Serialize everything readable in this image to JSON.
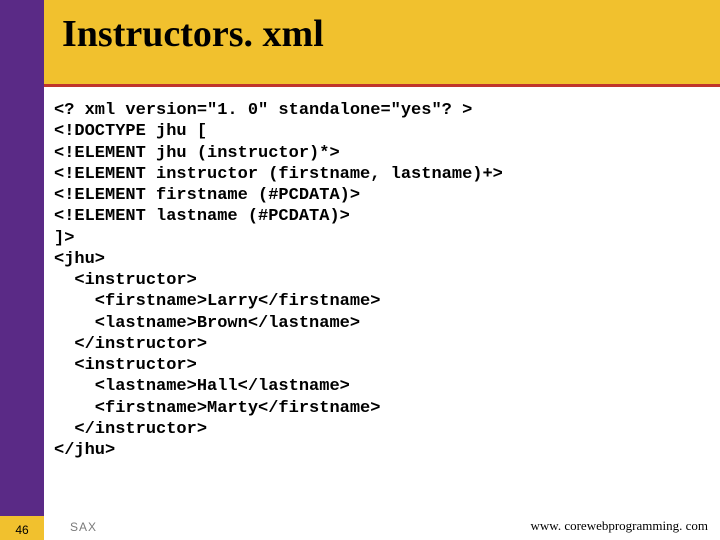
{
  "title": "Instructors. xml",
  "code": "<? xml version=\"1. 0\" standalone=\"yes\"? >\n<!DOCTYPE jhu [\n<!ELEMENT jhu (instructor)*>\n<!ELEMENT instructor (firstname, lastname)+>\n<!ELEMENT firstname (#PCDATA)>\n<!ELEMENT lastname (#PCDATA)>\n]>\n<jhu>\n  <instructor>\n    <firstname>Larry</firstname>\n    <lastname>Brown</lastname>\n  </instructor>\n  <instructor>\n    <lastname>Hall</lastname>\n    <firstname>Marty</firstname>\n  </instructor>\n</jhu>",
  "footer": {
    "page_number": "46",
    "left_label": "SAX",
    "right_label": "www. corewebprogramming. com"
  }
}
